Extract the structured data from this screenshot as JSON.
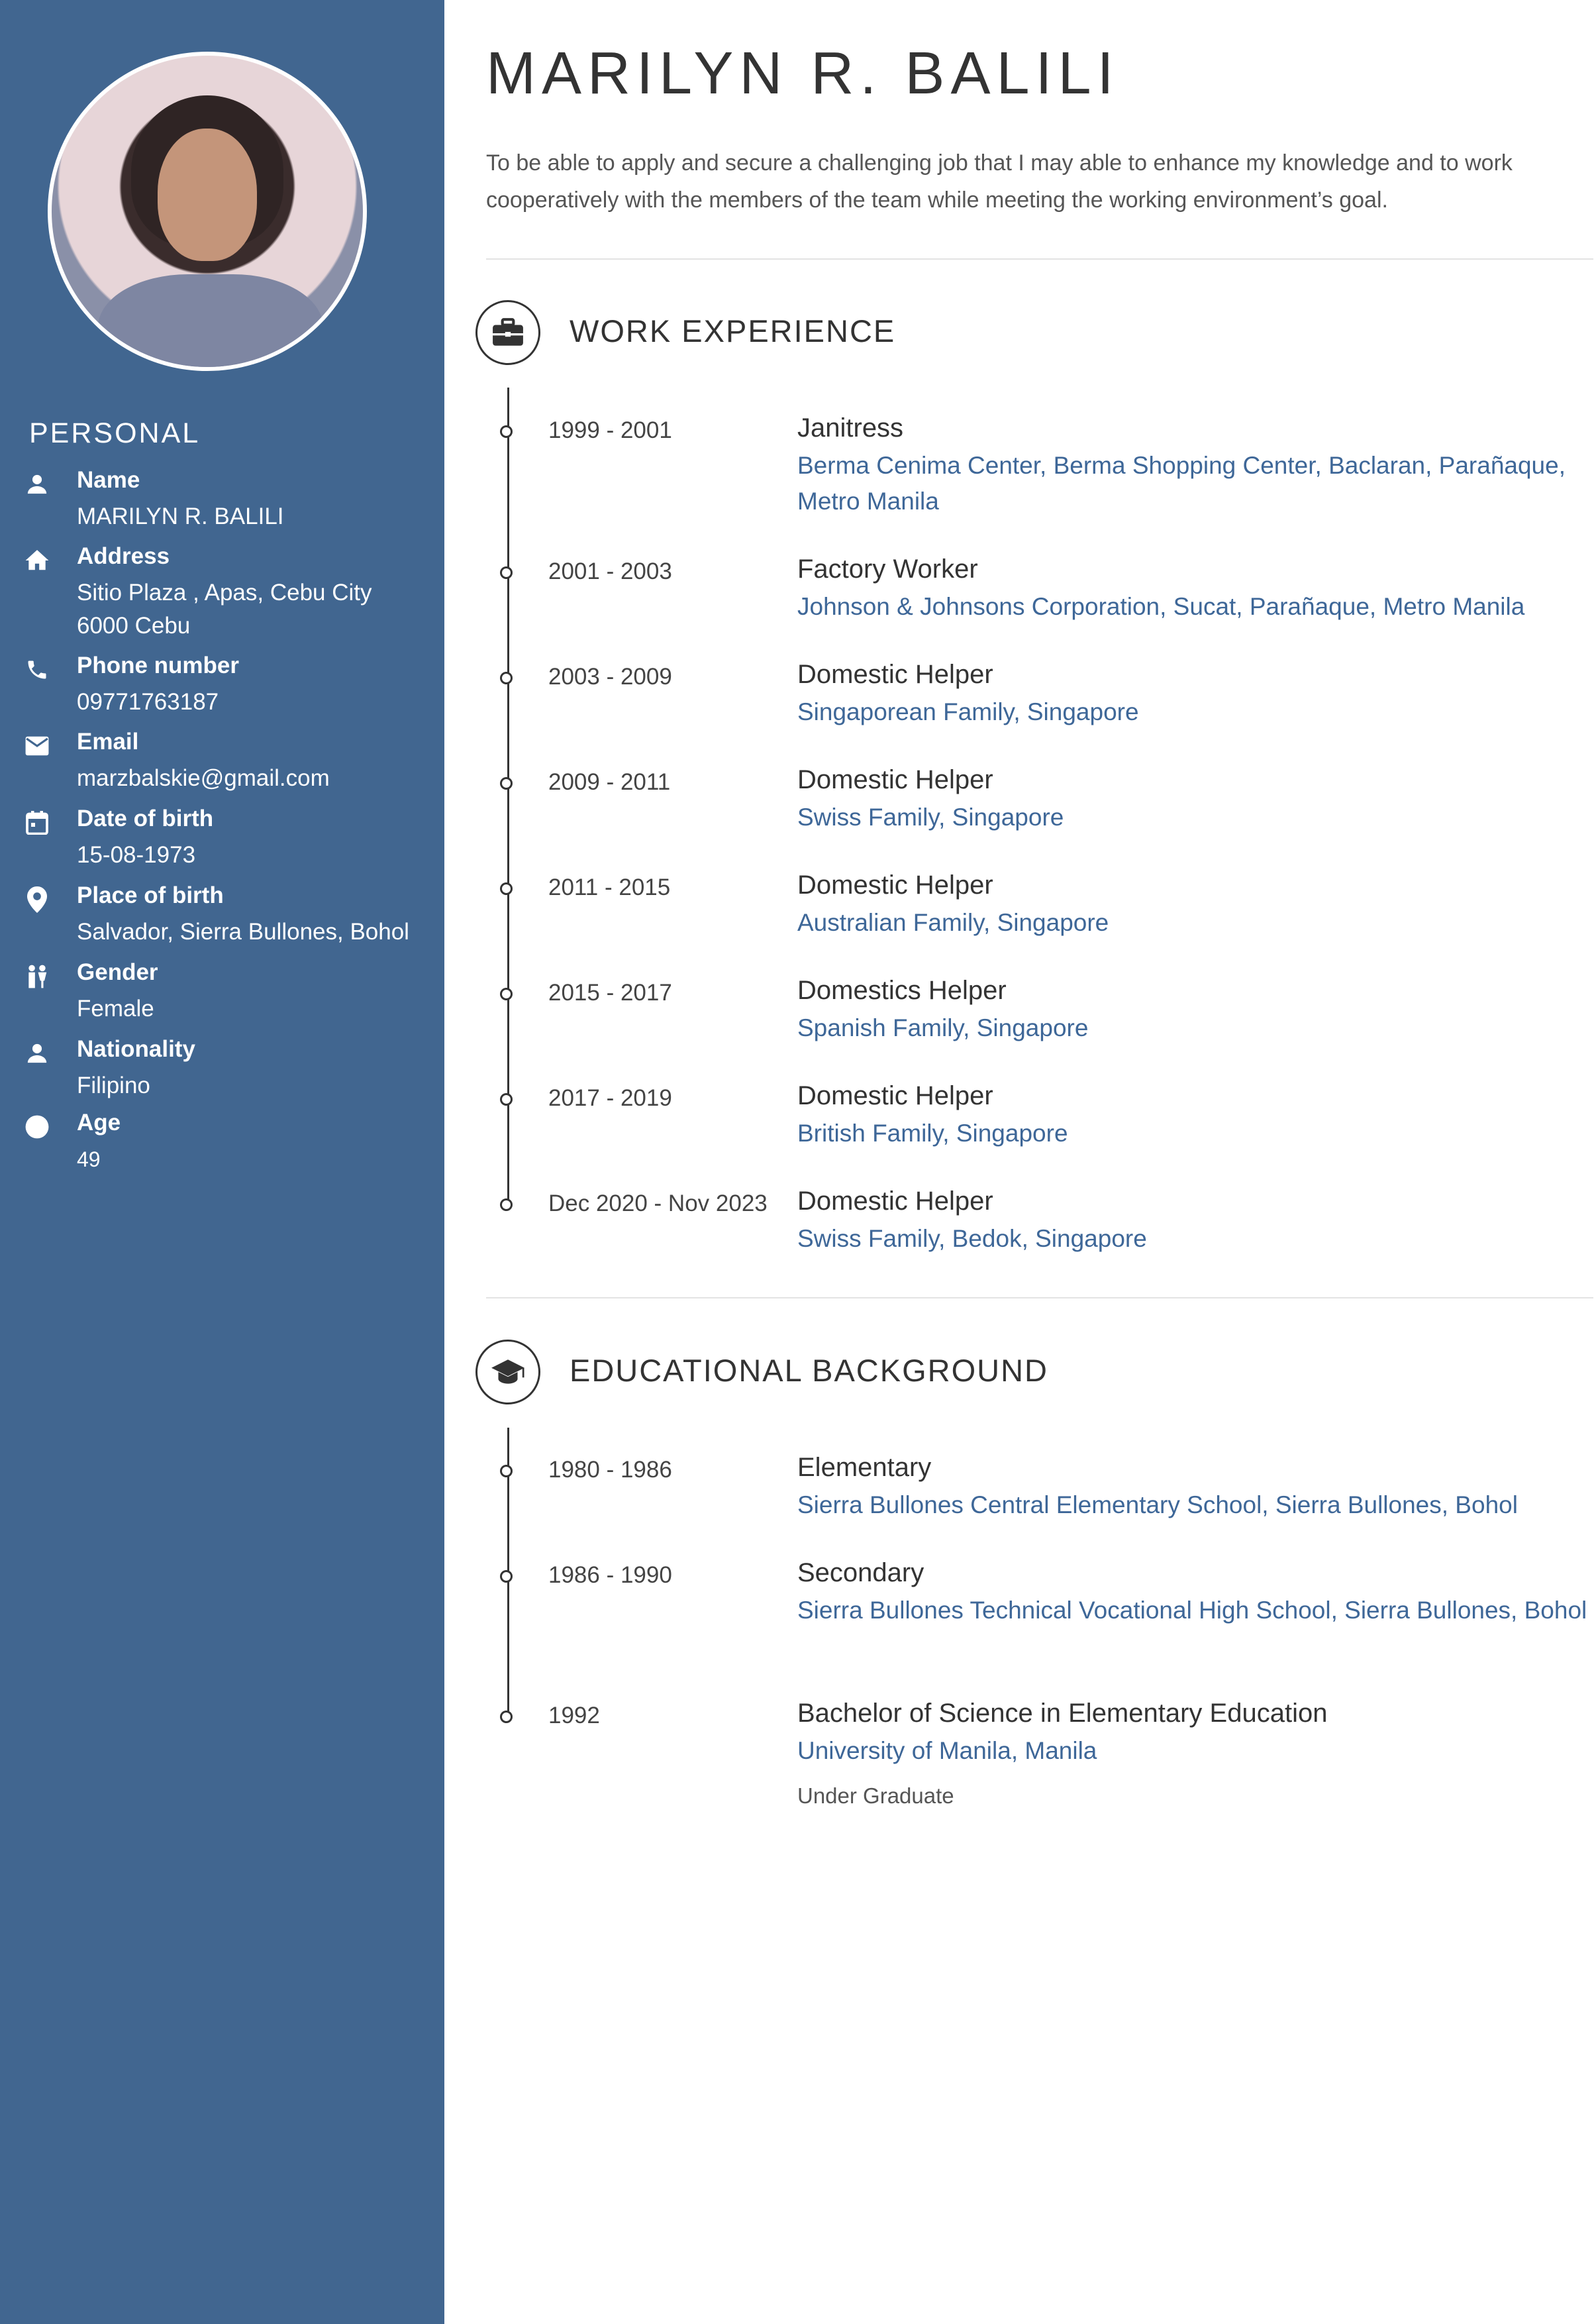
{
  "sidebar": {
    "photo_alt": "profile photo",
    "personal_title": "PERSONAL",
    "items": [
      {
        "icon": "person-icon",
        "label": "Name",
        "value": "MARILYN R. BALILI",
        "value2": ""
      },
      {
        "icon": "home-icon",
        "label": "Address",
        "value": "Sitio Plaza , Apas, Cebu City",
        "value2": "6000 Cebu"
      },
      {
        "icon": "phone-icon",
        "label": "Phone number",
        "value": "09771763187",
        "value2": ""
      },
      {
        "icon": "email-icon",
        "label": "Email",
        "value": "marzbalskie@gmail.com",
        "value2": ""
      },
      {
        "icon": "calendar-icon",
        "label": "Date of birth",
        "value": "15-08-1973",
        "value2": ""
      },
      {
        "icon": "location-pin-icon",
        "label": "Place of birth",
        "value": "Salvador, Sierra Bullones, Bohol",
        "value2": ""
      },
      {
        "icon": "gender-icon",
        "label": "Gender",
        "value": "Female",
        "value2": ""
      },
      {
        "icon": "person-icon",
        "label": "Nationality",
        "value": "Filipino",
        "value2": ""
      },
      {
        "icon": "circle-icon",
        "label": "Age",
        "value": "49",
        "value2": ""
      }
    ]
  },
  "main": {
    "name": "MARILYN R. BALILI",
    "objective": "To be able to apply and secure a challenging job that I may able to enhance my knowledge and to work cooperatively with the members of the team while meeting the working environment’s goal.",
    "work": {
      "title": "WORK EXPERIENCE",
      "icon": "briefcase-icon",
      "entries": [
        {
          "date": "1999 - 2001",
          "role": "Janitress",
          "place": "Berma Cenima Center, Berma Shopping Center, Baclaran, Parañaque, Metro Manila"
        },
        {
          "date": "2001 - 2003",
          "role": "Factory Worker",
          "place": "Johnson & Johnsons Corporation, Sucat, Parañaque, Metro Manila"
        },
        {
          "date": "2003 - 2009",
          "role": "Domestic Helper",
          "place": "Singaporean Family, Singapore"
        },
        {
          "date": "2009 - 2011",
          "role": "Domestic Helper",
          "place": "Swiss Family, Singapore"
        },
        {
          "date": "2011 - 2015",
          "role": "Domestic Helper",
          "place": "Australian Family, Singapore"
        },
        {
          "date": "2015 - 2017",
          "role": "Domestics Helper",
          "place": "Spanish Family, Singapore"
        },
        {
          "date": "2017 - 2019",
          "role": "Domestic Helper",
          "place": "British Family, Singapore"
        },
        {
          "date": "Dec 2020 - Nov 2023",
          "role": "Domestic Helper",
          "place": "Swiss Family, Bedok, Singapore"
        }
      ]
    },
    "education": {
      "title": "EDUCATIONAL BACKGROUND",
      "icon": "graduation-cap-icon",
      "entries": [
        {
          "date": "1980 - 1986",
          "role": "Elementary",
          "place": "Sierra Bullones Central Elementary School, Sierra Bullones, Bohol",
          "note": ""
        },
        {
          "date": "1986 - 1990",
          "role": "Secondary",
          "place": "Sierra Bullones Technical Vocational High School, Sierra Bullones, Bohol",
          "note": ""
        },
        {
          "date": "1992",
          "role": "Bachelor of Science in Elementary Education",
          "place": "University of Manila, Manila",
          "note": "Under Graduate"
        }
      ]
    }
  },
  "colors": {
    "sidebar": "#416690",
    "accent_text": "#3e6798",
    "text": "#333333"
  }
}
